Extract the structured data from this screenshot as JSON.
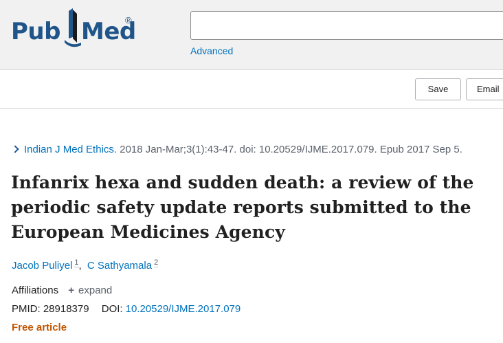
{
  "header": {
    "logo": {
      "text_pub": "Pub",
      "text_med": "Med",
      "registered": "®",
      "icon": "pubmed-book-icon"
    },
    "search": {
      "value": "",
      "placeholder": ""
    },
    "advanced_label": "Advanced"
  },
  "toolbar": {
    "save_label": "Save",
    "email_label": "Email"
  },
  "article": {
    "journal": "Indian J Med Ethics.",
    "citation": "2018 Jan-Mar;3(1):43-47. doi: 10.20529/IJME.2017.079. Epub 2017 Sep 5.",
    "title": "Infanrix hexa and sudden death: a review of the periodic safety update reports submitted to the European Medicines Agency",
    "authors": [
      {
        "name": "Jacob Puliyel",
        "aff": "1"
      },
      {
        "name": "C Sathyamala",
        "aff": "2"
      }
    ],
    "author_separator": ",",
    "affiliations_label": "Affiliations",
    "expand_label": "expand",
    "pmid_label": "PMID:",
    "pmid": "28918379",
    "doi_label": "DOI:",
    "doi": "10.20529/IJME.2017.079",
    "free_label": "Free article"
  },
  "colors": {
    "link": "#0071bc",
    "logo": "#20558a",
    "free_article": "#c05600",
    "header_bg": "#f1f1f1"
  }
}
